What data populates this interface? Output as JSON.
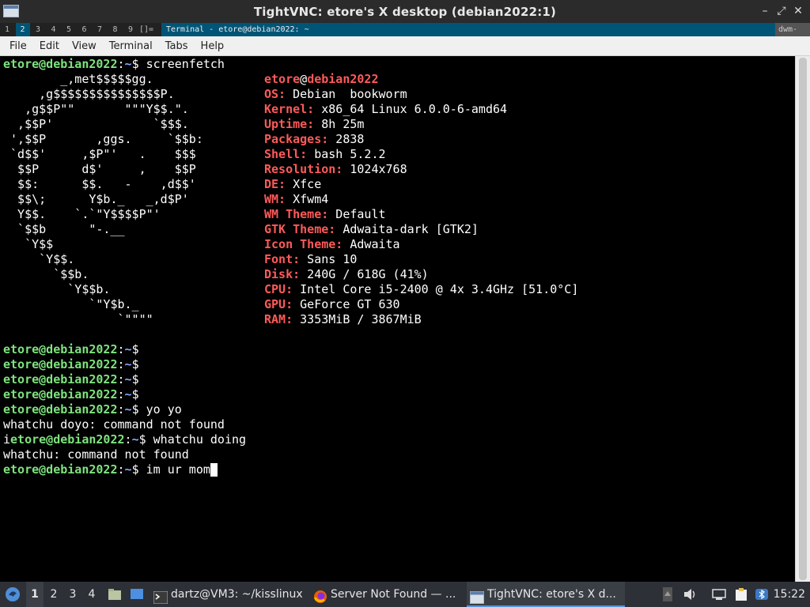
{
  "vnc_window": {
    "title": "TightVNC: etore's X desktop (debian2022:1)",
    "minimize": "–",
    "maximize": "⤢",
    "close": "✕"
  },
  "dwm_bar": {
    "tags": [
      "1",
      "2",
      "3",
      "4",
      "5",
      "6",
      "7",
      "8",
      "9"
    ],
    "selected_tag": "2",
    "layout_symbol": "[]=",
    "window_title": "Terminal - etore@debian2022: ~",
    "status": "dwm-"
  },
  "terminal_menu": [
    "File",
    "Edit",
    "View",
    "Terminal",
    "Tabs",
    "Help"
  ],
  "terminal": {
    "prompt_user_host": "etore@debian2022",
    "prompt_path": "~",
    "prompt_symbol": "$",
    "first_command": "screenfetch",
    "ascii_logo": [
      "        _,met$$$$$gg.",
      "     ,g$$$$$$$$$$$$$$$P.",
      "   ,g$$P\"\"       \"\"\"Y$$.\".",
      "  ,$$P'              `$$$.",
      " ',$$P       ,ggs.     `$$b:",
      " `d$$'     ,$P\"'   .    $$$",
      "  $$P      d$'     ,    $$P",
      "  $$:      $$.   -    ,d$$'",
      "  $$\\;      Y$b._   _,d$P'",
      "  Y$$.    `.`\"Y$$$$P\"'",
      "  `$$b      \"-.__",
      "   `Y$$",
      "     `Y$$.",
      "       `$$b.",
      "         `Y$$b.",
      "            `\"Y$b._",
      "                `\"\"\"\""
    ],
    "info_user": "etore",
    "info_at": "@",
    "info_host": "debian2022",
    "info": [
      {
        "key": "OS:",
        "value": " Debian  bookworm"
      },
      {
        "key": "Kernel:",
        "value": " x86_64 Linux 6.0.0-6-amd64"
      },
      {
        "key": "Uptime:",
        "value": " 8h 25m"
      },
      {
        "key": "Packages:",
        "value": " 2838"
      },
      {
        "key": "Shell:",
        "value": " bash 5.2.2"
      },
      {
        "key": "Resolution:",
        "value": " 1024x768"
      },
      {
        "key": "DE:",
        "value": " Xfce"
      },
      {
        "key": "WM:",
        "value": " Xfwm4"
      },
      {
        "key": "WM Theme:",
        "value": " Default"
      },
      {
        "key": "GTK Theme:",
        "value": " Adwaita-dark [GTK2]"
      },
      {
        "key": "Icon Theme:",
        "value": " Adwaita"
      },
      {
        "key": "Font:",
        "value": " Sans 10"
      },
      {
        "key": "Disk:",
        "value": " 240G / 618G (41%)"
      },
      {
        "key": "CPU:",
        "value": " Intel Core i5-2400 @ 4x 3.4GHz [51.0°C]"
      },
      {
        "key": "GPU:",
        "value": " GeForce GT 630"
      },
      {
        "key": "RAM:",
        "value": " 3353MiB / 3867MiB"
      }
    ],
    "later_lines": [
      {
        "type": "prompt",
        "prefix": "",
        "cmd": ""
      },
      {
        "type": "prompt",
        "prefix": "",
        "cmd": ""
      },
      {
        "type": "prompt",
        "prefix": "",
        "cmd": ""
      },
      {
        "type": "prompt",
        "prefix": "",
        "cmd": ""
      },
      {
        "type": "prompt",
        "prefix": "",
        "cmd": " yo yo"
      },
      {
        "type": "output",
        "text": "whatchu doyo: command not found"
      },
      {
        "type": "prompt",
        "prefix": "i",
        "cmd": " whatchu doing"
      },
      {
        "type": "output",
        "text": "whatchu: command not found"
      },
      {
        "type": "prompt",
        "prefix": "",
        "cmd": " im ur mom",
        "cursor": true
      }
    ]
  },
  "taskbar": {
    "workspaces": [
      "1",
      "2",
      "3",
      "4"
    ],
    "active_workspace": "1",
    "tasks": [
      {
        "label": "dartz@VM3: ~/kisslinux",
        "icon": "terminal-icon"
      },
      {
        "label": "Server Not Found — ...",
        "icon": "firefox-icon"
      },
      {
        "label": "TightVNC: etore's X d...",
        "icon": "vnc-window-icon",
        "active": true
      }
    ],
    "clock": "15:22"
  },
  "colors": {
    "prompt_green": "#7ee37e",
    "info_key_red": "#ff5a5a",
    "selection_blue": "#005577"
  }
}
